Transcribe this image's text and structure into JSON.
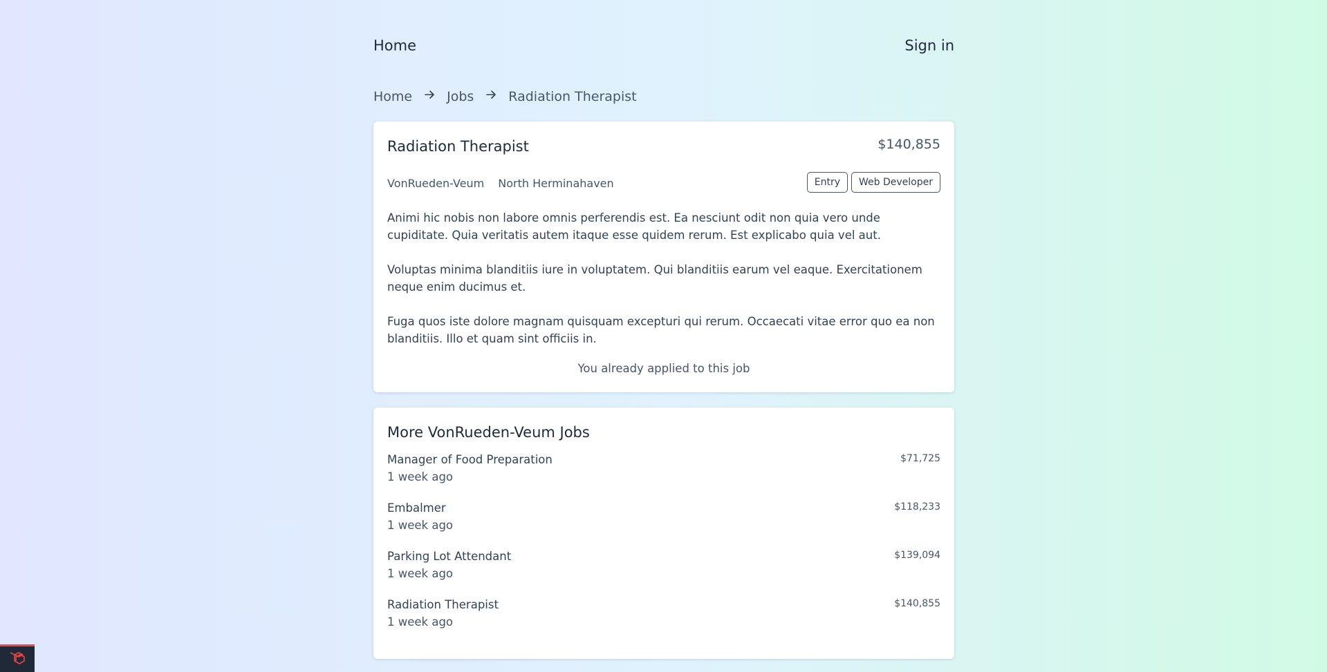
{
  "nav": {
    "home_label": "Home",
    "signin_label": "Sign in"
  },
  "breadcrumb": {
    "items": [
      "Home",
      "Jobs",
      "Radiation Therapist"
    ]
  },
  "job": {
    "title": "Radiation Therapist",
    "salary": "$140,855",
    "company": "VonRueden-Veum",
    "location": "North Herminahaven",
    "tags": [
      "Entry",
      "Web Developer"
    ],
    "description": [
      "Animi hic nobis non labore omnis perferendis est. Ea nesciunt odit non quia vero unde cupiditate. Quia veritatis autem itaque esse quidem rerum. Est explicabo quia vel aut.",
      "Voluptas minima blanditiis iure in voluptatem. Qui blanditiis earum vel eaque. Exercitationem neque enim ducimus et.",
      "Fuga quos iste dolore magnam quisquam excepturi qui rerum. Occaecati vitae error quo ea non blanditiis. Illo et quam sint officiis in."
    ],
    "applied_status": "You already applied to this job"
  },
  "more_jobs": {
    "title": "More VonRueden-Veum Jobs",
    "items": [
      {
        "title": "Manager of Food Preparation",
        "posted": "1 week ago",
        "salary": "$71,725"
      },
      {
        "title": "Embalmer",
        "posted": "1 week ago",
        "salary": "$118,233"
      },
      {
        "title": "Parking Lot Attendant",
        "posted": "1 week ago",
        "salary": "$139,094"
      },
      {
        "title": "Radiation Therapist",
        "posted": "1 week ago",
        "salary": "$140,855"
      }
    ]
  },
  "colors": {
    "accent_laravel": "#ef4444",
    "badge_bg": "#1f2937"
  },
  "icons": {
    "breadcrumb_separator": "arrow-right-icon",
    "badge": "laravel-logo-icon"
  }
}
